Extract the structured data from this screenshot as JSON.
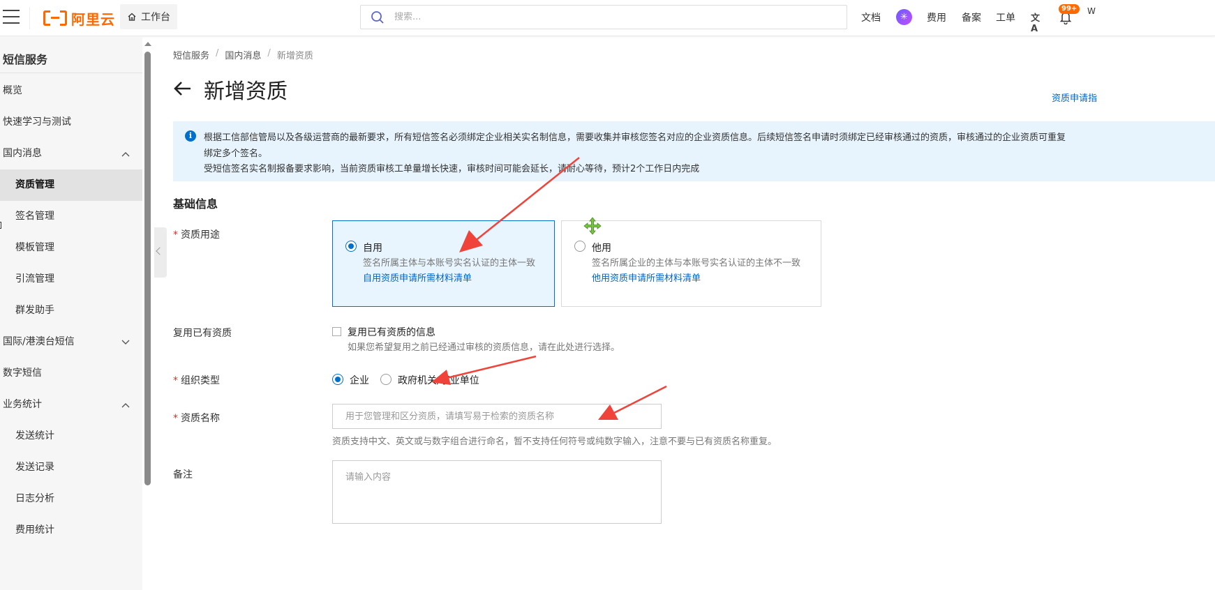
{
  "header": {
    "brand": "阿里云",
    "workbench_label": "工作台",
    "search_placeholder": "搜索...",
    "nav_docs": "文档",
    "nav_fees": "费用",
    "nav_filing": "备案",
    "nav_ticket": "工单",
    "notification_badge": "99+",
    "user_initial": "W"
  },
  "sidebar": {
    "title": "短信服务",
    "items": [
      {
        "label": "概览"
      },
      {
        "label": "快速学习与测试"
      },
      {
        "label": "国内消息"
      },
      {
        "label": "资质管理"
      },
      {
        "label": "签名管理"
      },
      {
        "label": "模板管理"
      },
      {
        "label": "引流管理"
      },
      {
        "label": "群发助手"
      },
      {
        "label": "国际/港澳台短信"
      },
      {
        "label": "数字短信"
      },
      {
        "label": "业务统计"
      },
      {
        "label": "发送统计"
      },
      {
        "label": "发送记录"
      },
      {
        "label": "日志分析"
      },
      {
        "label": "费用统计"
      }
    ]
  },
  "breadcrumb": [
    "短信服务",
    "国内消息",
    "新增资质"
  ],
  "page": {
    "title": "新增资质",
    "right_link": "资质申请指"
  },
  "notice": {
    "line1": "根据工信部信管局以及各级运营商的最新要求，所有短信签名必须绑定企业相关实名制信息，需要收集并审核您签名对应的企业资质信息。后续短信签名申请时须绑定已经审核通过的资质，审核通过的企业资质可重复",
    "line2": "绑定多个签名。",
    "line3": "受短信签名实名制报备要求影响，当前资质审核工单量增长快速，审核时间可能会延长，请耐心等待，预计2个工作日内完成"
  },
  "form": {
    "section_title": "基础信息",
    "usage": {
      "label": "资质用途",
      "self": {
        "title": "自用",
        "desc": "签名所属主体与本账号实名认证的主体一致",
        "link": "自用资质申请所需材料清单"
      },
      "other": {
        "title": "他用",
        "desc": "签名所属企业的主体与本账号实名认证的主体不一致",
        "link": "他用资质申请所需材料清单"
      }
    },
    "reuse": {
      "label": "复用已有资质",
      "checkbox_label": "复用已有资质的信息",
      "hint": "如果您希望复用之前已经通过审核的资质信息，请在此处进行选择。"
    },
    "org_type": {
      "label": "组织类型",
      "opt1": "企业",
      "opt2": "政府机关/事业单位"
    },
    "name": {
      "label": "资质名称",
      "placeholder": "用于您管理和区分资质，请填写易于检索的资质名称",
      "hint": "资质支持中文、英文或与数字组合进行命名，暂不支持任何符号或纯数字输入，注意不要与已有资质名称重复。"
    },
    "remark": {
      "label": "备注",
      "placeholder": "请输入内容"
    }
  },
  "colors": {
    "brand": "#ff6a00",
    "primary": "#0070cc",
    "annotation": "#f0433a"
  }
}
